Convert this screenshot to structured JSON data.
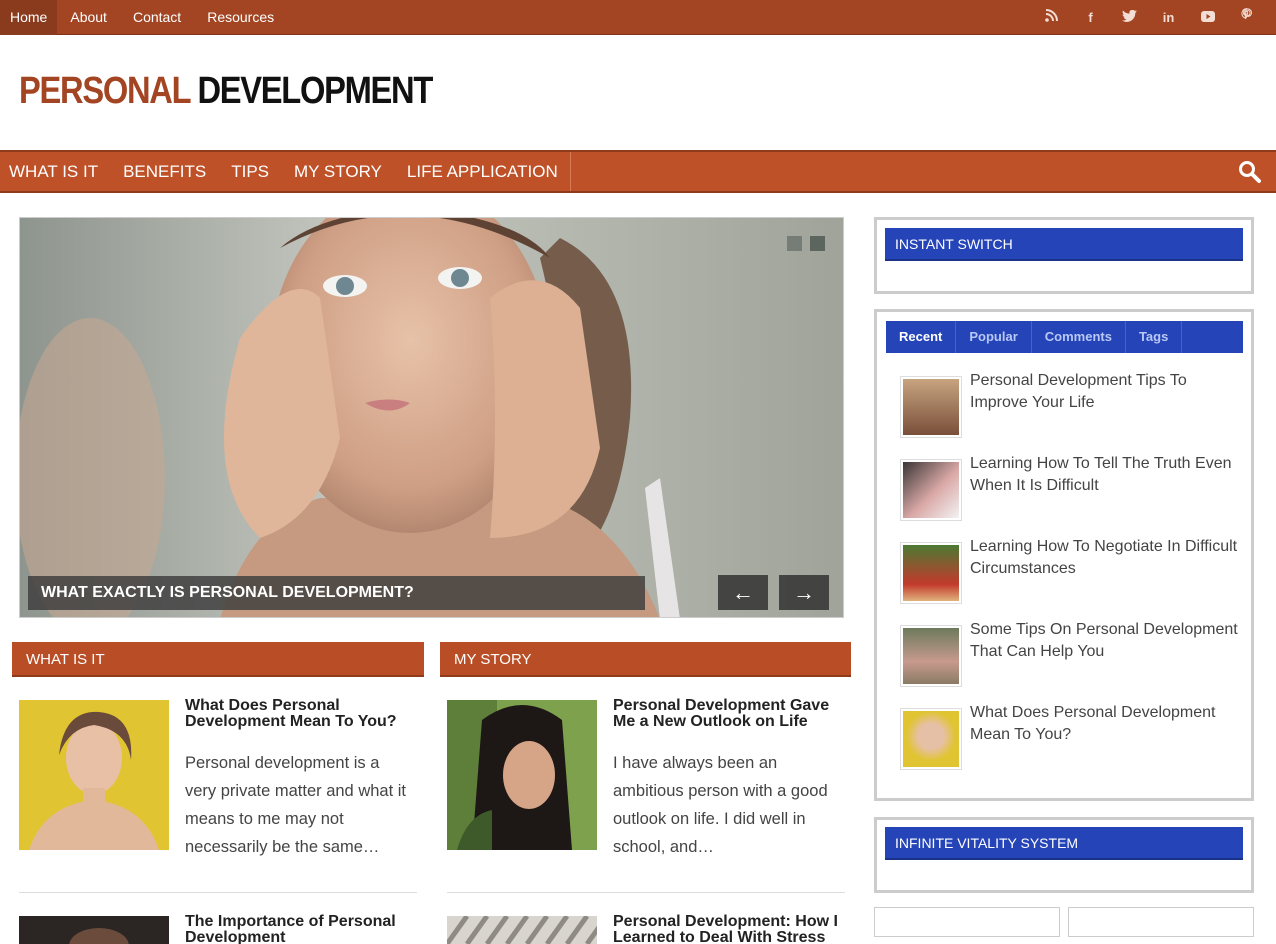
{
  "topnav": {
    "items": [
      {
        "label": "Home",
        "active": true
      },
      {
        "label": "About"
      },
      {
        "label": "Contact"
      },
      {
        "label": "Resources"
      }
    ],
    "social": [
      "rss-icon",
      "facebook-icon",
      "twitter-icon",
      "linkedin-icon",
      "youtube-icon",
      "pinterest-icon"
    ]
  },
  "header": {
    "logo_part1": "PERSONAL",
    "logo_part2": "DEVELOPMENT"
  },
  "mainnav": {
    "items": [
      "WHAT IS IT",
      "BENEFITS",
      "TIPS",
      "MY STORY",
      "LIFE APPLICATION"
    ]
  },
  "slider": {
    "caption": "WHAT EXACTLY IS PERSONAL DEVELOPMENT?",
    "prev": "←",
    "next": "→"
  },
  "sections": [
    {
      "heading": "WHAT IS IT",
      "posts": [
        {
          "title": "What Does Personal Development Mean To You?",
          "excerpt": "Personal development is a very private matter and what it means to me may not necessarily be the same…"
        },
        {
          "title": "The Importance of Personal Development",
          "excerpt": ""
        }
      ]
    },
    {
      "heading": "MY STORY",
      "posts": [
        {
          "title": "Personal Development Gave Me a New Outlook on Life",
          "excerpt": "I have always been an ambitious person with a good outlook on life. I did well in school, and…"
        },
        {
          "title": "Personal Development: How I Learned to Deal With Stress",
          "excerpt": ""
        }
      ]
    }
  ],
  "sidebar": {
    "instant_switch": "INSTANT SWITCH",
    "tabs": [
      "Recent",
      "Popular",
      "Comments",
      "Tags"
    ],
    "recent": [
      "Personal Development Tips To Improve Your Life",
      "Learning How To Tell The Truth Even When It Is Difficult",
      "Learning How To Negotiate In Difficult Circumstances",
      "Some Tips On Personal Development That Can Help You",
      "What Does Personal Development Mean To You?"
    ],
    "infinite_vitality": "INFINITE VITALITY SYSTEM"
  },
  "colors": {
    "brand": "#a34523",
    "nav": "#bf5128",
    "widget": "#2444b8"
  }
}
